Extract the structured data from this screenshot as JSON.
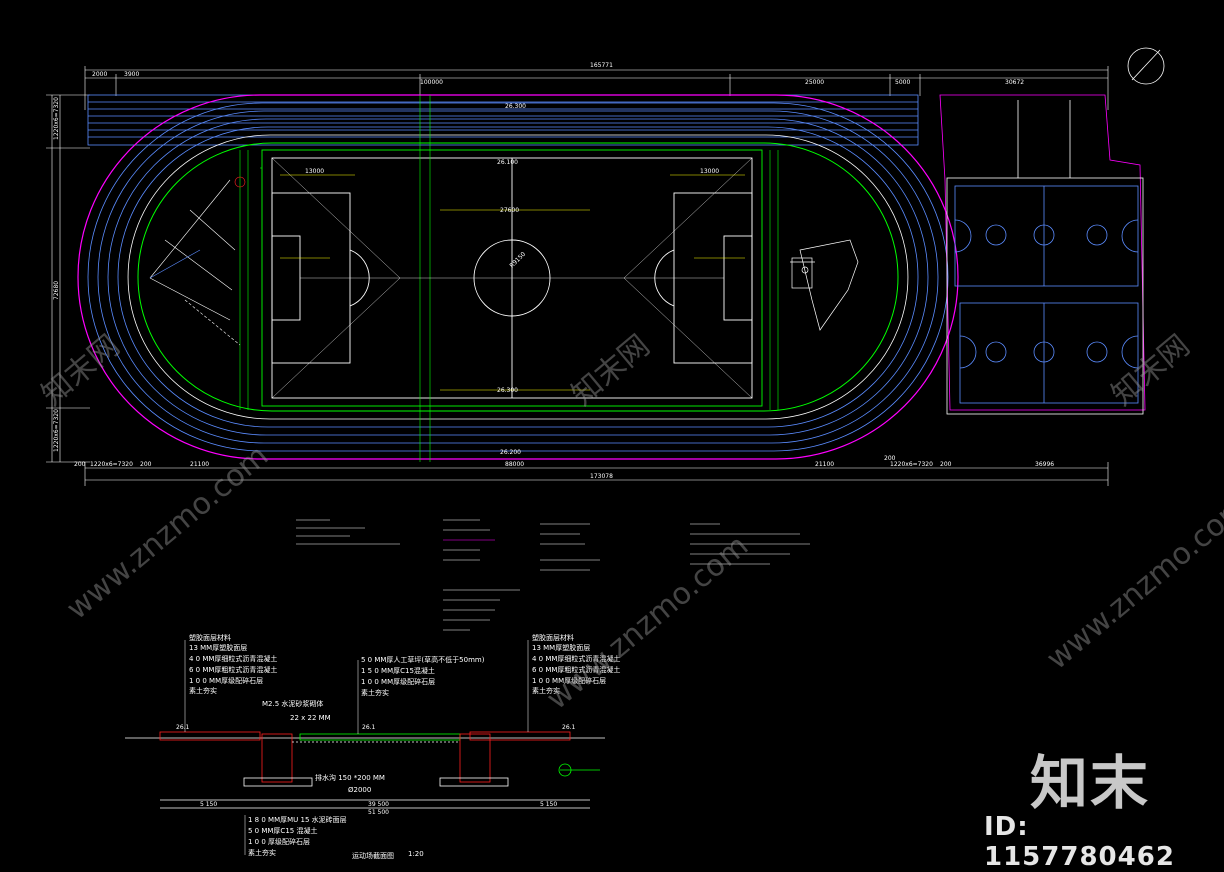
{
  "drawing": {
    "overall_length": "165771",
    "top_dims": [
      "2000",
      "3900",
      "100000",
      "25000",
      "5000",
      "30672"
    ],
    "bottom_dims": [
      "200",
      "1220x6=7320",
      "200",
      "21100",
      "88000",
      "21100",
      "200",
      "1220x6=7320",
      "200",
      "36996"
    ],
    "bottom_total": "173078",
    "left_dims": [
      "1220x6=7320",
      "200",
      "72680",
      "1220x6=7320",
      "200"
    ],
    "field_dims": [
      "26.300",
      "26.100",
      "26.300",
      "26.200"
    ],
    "field_width": "13000",
    "field_length": "27600",
    "center_radius": "R9150",
    "colors": {
      "track": "#ff00ff",
      "lines": "#00ff00",
      "dims": "#ffffff",
      "field": "#ffffff",
      "courts": "#5b8cff",
      "axes": "#ffff00",
      "detail": "#ff2020"
    }
  },
  "section": {
    "title": "运动场截面图",
    "scale": "1:20",
    "left_layers": [
      "塑胶面层材料",
      "13 MM厚塑胶面层",
      "4 0 MM厚细粒式沥青混凝土",
      "6 0 MM厚粗粒式沥青混凝土",
      "1 0 0 MM厚级配碎石层",
      "素土夯实"
    ],
    "mid_layers": [
      "5 0 MM厚人工草坪(草高不低于50mm)",
      "1 5 0 MM厚C15混凝土",
      "1 0 0 MM厚级配碎石层",
      "素土夯实"
    ],
    "right_layers": [
      "塑胶面层材料",
      "13 MM厚塑胶面层",
      "4 0 MM厚细粒式沥青混凝土",
      "6 0 MM厚粗粒式沥青混凝土",
      "1 0 0 MM厚级配碎石层",
      "素土夯实"
    ],
    "bottom_layers": [
      "1 8 0 MM厚MU 15 水泥砖面层",
      "5 0 MM厚C15 混凝土",
      "1 0 0 厚级配碎石层",
      "素土夯实"
    ],
    "notes_left": [
      "M2.5 水泥砂浆砌体",
      "22 x 22 MM",
      "排水沟 150 *200 MM",
      "Ø2000"
    ],
    "dims": [
      "5 150",
      "39 500",
      "5 150",
      "51 500"
    ],
    "levels": [
      "26.1",
      "26.1",
      "26.1"
    ]
  },
  "watermark": {
    "logo": "知末",
    "id": "ID: 1157780462",
    "site": "www.znzmo.com",
    "site_cn": "知末网"
  }
}
